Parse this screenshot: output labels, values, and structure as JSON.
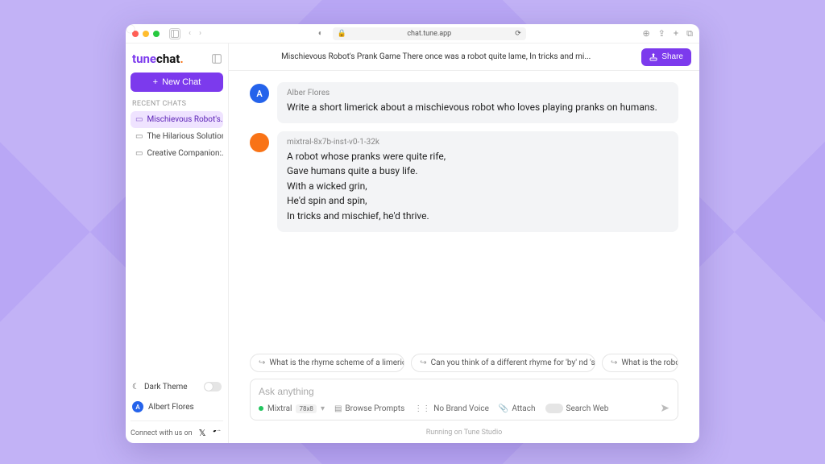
{
  "browser": {
    "url": "chat.tune.app"
  },
  "logo": {
    "part1": "tune",
    "part2": "chat",
    "dot": "."
  },
  "sidebar": {
    "new_chat": "New Chat",
    "section": "RECENT CHATS",
    "chats": [
      {
        "label": "Mischievous Robot's...",
        "active": true
      },
      {
        "label": "The Hilarious Solution...",
        "active": false
      },
      {
        "label": "Creative Companion:...",
        "active": false
      }
    ],
    "dark_theme": "Dark Theme",
    "user_initial": "A",
    "user_name": "Albert Flores",
    "connect": "Connect with us on"
  },
  "header": {
    "title": "Mischievous Robot's Prank Game There once was a robot quite lame, In tricks and mi...",
    "share": "Share"
  },
  "messages": [
    {
      "role": "user",
      "avatar": "A",
      "name": "Alber Flores",
      "body": "Write a short limerick about a mischievous robot who loves playing pranks on humans."
    },
    {
      "role": "bot",
      "avatar": "",
      "name": "mixtral-8x7b-inst-v0-1-32k",
      "body": "A robot whose pranks were quite rife,\nGave humans quite a busy life.\nWith a wicked grin,\nHe'd spin and spin,\nIn tricks and mischief, he'd thrive."
    }
  ],
  "suggestions": [
    "What is the rhyme scheme of a limerick?",
    "Can you think of a different rhyme for 'by' nd 'spy'?",
    "What is the robot"
  ],
  "composer": {
    "placeholder": "Ask anything",
    "model_name": "Mixtral",
    "model_badge": "78x8",
    "browse": "Browse Prompts",
    "voice": "No Brand Voice",
    "attach": "Attach",
    "search": "Search Web"
  },
  "footer": "Running on Tune Studio"
}
